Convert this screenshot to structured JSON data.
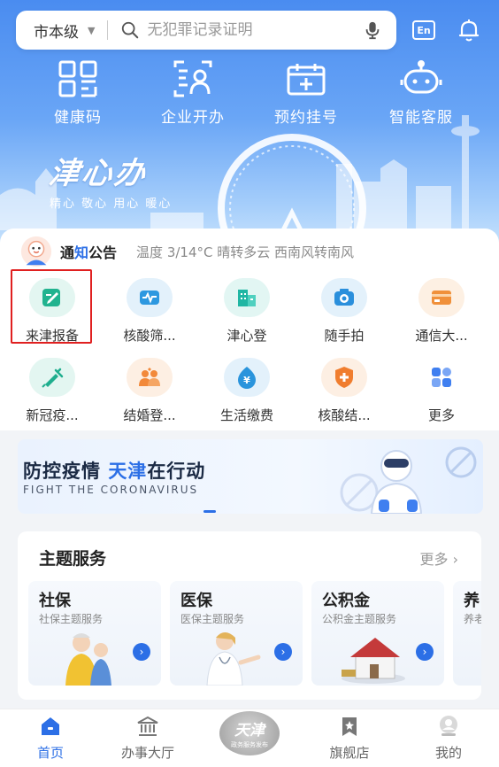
{
  "header": {
    "city": "市本级",
    "search_placeholder": "无犯罪记录证明",
    "lang_label": "En"
  },
  "quick_actions": [
    {
      "label": "健康码",
      "icon": "qr-code-icon"
    },
    {
      "label": "企业开办",
      "icon": "business-id-icon"
    },
    {
      "label": "预约挂号",
      "icon": "medical-kit-icon"
    },
    {
      "label": "智能客服",
      "icon": "robot-icon"
    }
  ],
  "brand": {
    "logo_text": "津心办",
    "slogan": "精心 敬心 用心 暖心"
  },
  "notice": {
    "title_a": "通",
    "title_b": "知",
    "title_c": "公告",
    "weather": "温度 3/14°C 晴转多云 西南风转南风"
  },
  "services": [
    {
      "label": "来津报备",
      "icon": "report-edit-icon",
      "bg": "#e3f6f1",
      "color": "#21b38f"
    },
    {
      "label": "核酸筛...",
      "icon": "screening-icon",
      "bg": "#e3f1fb",
      "color": "#2d98e0"
    },
    {
      "label": "津心登",
      "icon": "building-icon",
      "bg": "#e2f6f3",
      "color": "#1fb6a3"
    },
    {
      "label": "随手拍",
      "icon": "camera-icon",
      "bg": "#e3f1fb",
      "color": "#2a8fdc"
    },
    {
      "label": "通信大...",
      "icon": "card-icon",
      "bg": "#fdf0e3",
      "color": "#f0903a"
    },
    {
      "label": "新冠疫...",
      "icon": "syringe-icon",
      "bg": "#e3f6f1",
      "color": "#1fae8e"
    },
    {
      "label": "结婚登...",
      "icon": "couple-icon",
      "bg": "#fdefe3",
      "color": "#f2893a"
    },
    {
      "label": "生活缴费",
      "icon": "yuan-icon",
      "bg": "#e3f1fb",
      "color": "#2a94dc"
    },
    {
      "label": "核酸结...",
      "icon": "shield-plus-icon",
      "bg": "#fdefe3",
      "color": "#f07d2e"
    },
    {
      "label": "更多",
      "icon": "grid-more-icon",
      "bg": "#ffffff",
      "color": "#3f7ff0"
    }
  ],
  "banner": {
    "title_a": "防控疫情 ",
    "title_b": "天津",
    "title_c": "在行动",
    "subtitle": "FIGHT THE CORONAVIRUS"
  },
  "themes": {
    "title": "主题服务",
    "more": "更多",
    "cards": [
      {
        "name": "社保",
        "desc": "社保主题服务"
      },
      {
        "name": "医保",
        "desc": "医保主题服务"
      },
      {
        "name": "公积金",
        "desc": "公积金主题服务"
      },
      {
        "name": "养",
        "desc": "养老"
      }
    ]
  },
  "bottom_nav": {
    "items": [
      {
        "label": "首页",
        "active": true
      },
      {
        "label": "办事大厅",
        "active": false
      },
      {
        "label": "旗舰店",
        "active": false
      },
      {
        "label": "我的",
        "active": false
      }
    ],
    "center_logo": "天津",
    "center_sub": "政务服务发布"
  },
  "colors": {
    "accent": "#2c6fe6",
    "hero_top": "#4a8cf0",
    "highlight_border": "#e02020"
  }
}
